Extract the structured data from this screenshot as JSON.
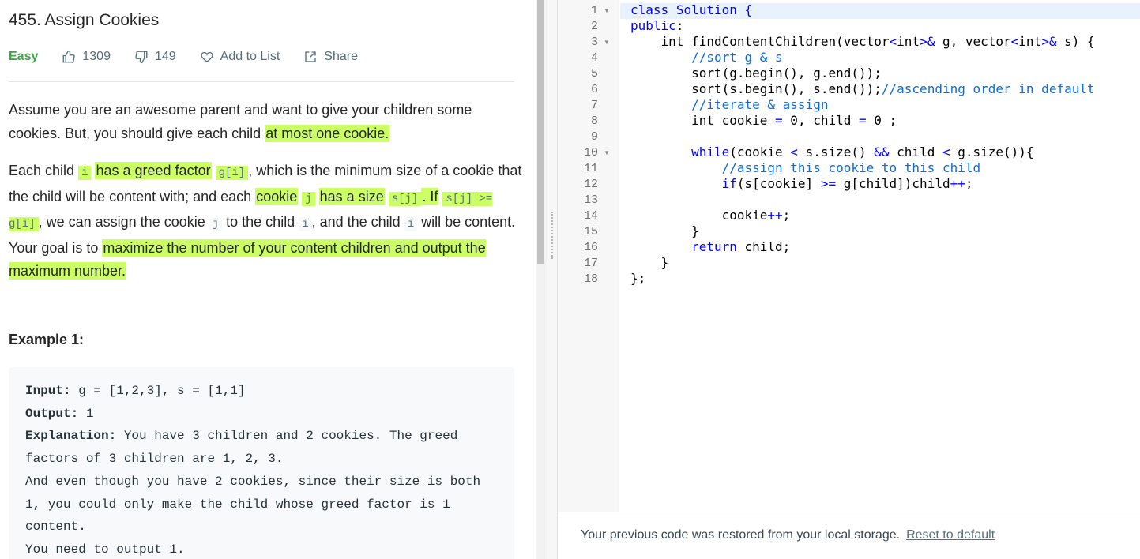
{
  "problem": {
    "title": "455. Assign Cookies",
    "difficulty": "Easy",
    "likes": "1309",
    "dislikes": "149",
    "add_to_list": "Add to List",
    "share": "Share"
  },
  "description": {
    "p1_a": "Assume you are an awesome parent and want to give your children some cookies. But, you should give each child ",
    "p1_hl": "at most one cookie.",
    "p2_1": "Each child ",
    "p2_i": "i",
    "p2_2": "has a greed factor",
    "p2_gi": "g[i]",
    "p2_3": ", which is the minimum size of a cookie that the child will be content with; and each ",
    "p2_4": "cookie",
    "p2_j": "j",
    "p2_5": "has a size",
    "p2_sj": "s[j]",
    "p2_6": ". If",
    "p2_cond": "s[j] >= g[i]",
    "p2_7": ", we can assign the cookie ",
    "p2_j2": "j",
    "p2_8": " to the child ",
    "p2_i2": "i",
    "p2_9": ", and the child ",
    "p2_i3": "i",
    "p2_10": " will be content. Your goal is to ",
    "p2_11": "maximize the number of your content children and output the maximum number."
  },
  "example": {
    "title": "Example 1:",
    "input_label": "Input:",
    "input_value": " g = [1,2,3], s = [1,1]",
    "output_label": "Output:",
    "output_value": " 1",
    "explanation_label": "Explanation:",
    "explanation_lines": [
      " You have 3 children and 2 cookies. The greed",
      "factors of 3 children are 1, 2, 3.",
      "And even though you have 2 cookies, since their size is both",
      "1, you could only make the child whose greed factor is 1",
      "content.",
      "You need to output 1."
    ]
  },
  "editor": {
    "line_numbers": [
      "1",
      "2",
      "3",
      "4",
      "5",
      "6",
      "7",
      "8",
      "9",
      "10",
      "11",
      "12",
      "13",
      "14",
      "15",
      "16",
      "17",
      "18"
    ],
    "folded_lines": [
      "1",
      "3",
      "10"
    ]
  },
  "footer": {
    "message": "Your previous code was restored from your local storage.",
    "reset_link": "Reset to default"
  }
}
